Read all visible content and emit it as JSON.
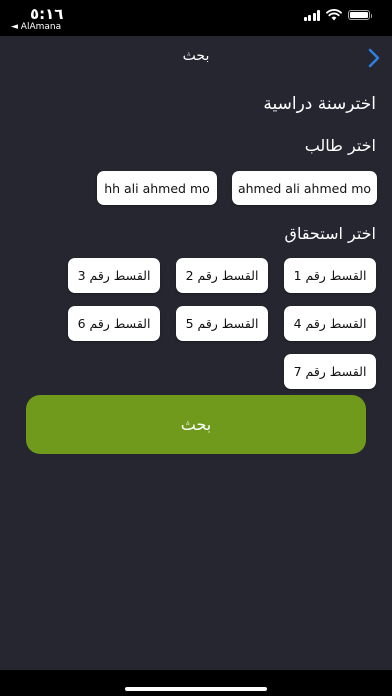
{
  "status_bar": {
    "time": "٥:١٦",
    "back_app": "◄ AlAmana"
  },
  "header": {
    "title": "بحث"
  },
  "sections": {
    "year_label": "اخترسنة دراسية",
    "student_label": "اختر طالب",
    "installment_label": "اختر استحقاق"
  },
  "students": [
    "ahmed ali ahmed mo",
    "hh ali ahmed mo"
  ],
  "installments": [
    "القسط رقم 1",
    "القسط رقم 2",
    "القسط رقم 3",
    "القسط رقم 4",
    "القسط رقم 5",
    "القسط رقم 6",
    "القسط رقم 7"
  ],
  "search_button": {
    "label": "بحث"
  },
  "icons": {
    "back": "chevron-right-icon",
    "wifi": "wifi-icon",
    "signal": "signal-icon",
    "battery": "battery-icon"
  },
  "colors": {
    "background": "#25262f",
    "accent_green": "#6f9a1c",
    "back_chevron": "#2f7fe0"
  }
}
